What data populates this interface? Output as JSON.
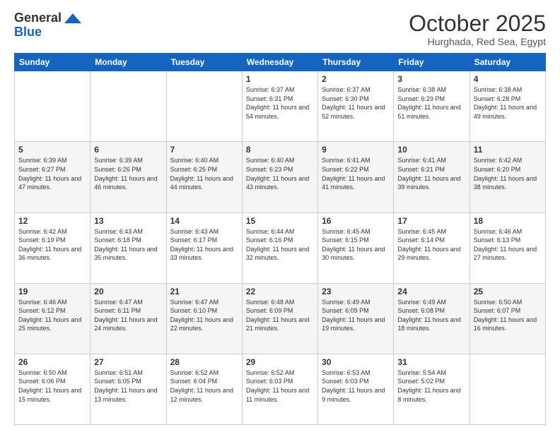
{
  "header": {
    "logo_general": "General",
    "logo_blue": "Blue",
    "month_title": "October 2025",
    "location": "Hurghada, Red Sea, Egypt"
  },
  "days_of_week": [
    "Sunday",
    "Monday",
    "Tuesday",
    "Wednesday",
    "Thursday",
    "Friday",
    "Saturday"
  ],
  "weeks": [
    [
      {
        "day": "",
        "detail": ""
      },
      {
        "day": "",
        "detail": ""
      },
      {
        "day": "",
        "detail": ""
      },
      {
        "day": "1",
        "detail": "Sunrise: 6:37 AM\nSunset: 6:31 PM\nDaylight: 11 hours\nand 54 minutes."
      },
      {
        "day": "2",
        "detail": "Sunrise: 6:37 AM\nSunset: 6:30 PM\nDaylight: 11 hours\nand 52 minutes."
      },
      {
        "day": "3",
        "detail": "Sunrise: 6:38 AM\nSunset: 6:29 PM\nDaylight: 11 hours\nand 51 minutes."
      },
      {
        "day": "4",
        "detail": "Sunrise: 6:38 AM\nSunset: 6:28 PM\nDaylight: 11 hours\nand 49 minutes."
      }
    ],
    [
      {
        "day": "5",
        "detail": "Sunrise: 6:39 AM\nSunset: 6:27 PM\nDaylight: 11 hours\nand 47 minutes."
      },
      {
        "day": "6",
        "detail": "Sunrise: 6:39 AM\nSunset: 6:26 PM\nDaylight: 11 hours\nand 46 minutes."
      },
      {
        "day": "7",
        "detail": "Sunrise: 6:40 AM\nSunset: 6:25 PM\nDaylight: 11 hours\nand 44 minutes."
      },
      {
        "day": "8",
        "detail": "Sunrise: 6:40 AM\nSunset: 6:23 PM\nDaylight: 11 hours\nand 43 minutes."
      },
      {
        "day": "9",
        "detail": "Sunrise: 6:41 AM\nSunset: 6:22 PM\nDaylight: 11 hours\nand 41 minutes."
      },
      {
        "day": "10",
        "detail": "Sunrise: 6:41 AM\nSunset: 6:21 PM\nDaylight: 11 hours\nand 39 minutes."
      },
      {
        "day": "11",
        "detail": "Sunrise: 6:42 AM\nSunset: 6:20 PM\nDaylight: 11 hours\nand 38 minutes."
      }
    ],
    [
      {
        "day": "12",
        "detail": "Sunrise: 6:42 AM\nSunset: 6:19 PM\nDaylight: 11 hours\nand 36 minutes."
      },
      {
        "day": "13",
        "detail": "Sunrise: 6:43 AM\nSunset: 6:18 PM\nDaylight: 11 hours\nand 35 minutes."
      },
      {
        "day": "14",
        "detail": "Sunrise: 6:43 AM\nSunset: 6:17 PM\nDaylight: 11 hours\nand 33 minutes."
      },
      {
        "day": "15",
        "detail": "Sunrise: 6:44 AM\nSunset: 6:16 PM\nDaylight: 11 hours\nand 32 minutes."
      },
      {
        "day": "16",
        "detail": "Sunrise: 6:45 AM\nSunset: 6:15 PM\nDaylight: 11 hours\nand 30 minutes."
      },
      {
        "day": "17",
        "detail": "Sunrise: 6:45 AM\nSunset: 6:14 PM\nDaylight: 11 hours\nand 29 minutes."
      },
      {
        "day": "18",
        "detail": "Sunrise: 6:46 AM\nSunset: 6:13 PM\nDaylight: 11 hours\nand 27 minutes."
      }
    ],
    [
      {
        "day": "19",
        "detail": "Sunrise: 6:46 AM\nSunset: 6:12 PM\nDaylight: 11 hours\nand 25 minutes."
      },
      {
        "day": "20",
        "detail": "Sunrise: 6:47 AM\nSunset: 6:11 PM\nDaylight: 11 hours\nand 24 minutes."
      },
      {
        "day": "21",
        "detail": "Sunrise: 6:47 AM\nSunset: 6:10 PM\nDaylight: 11 hours\nand 22 minutes."
      },
      {
        "day": "22",
        "detail": "Sunrise: 6:48 AM\nSunset: 6:09 PM\nDaylight: 11 hours\nand 21 minutes."
      },
      {
        "day": "23",
        "detail": "Sunrise: 6:49 AM\nSunset: 6:09 PM\nDaylight: 11 hours\nand 19 minutes."
      },
      {
        "day": "24",
        "detail": "Sunrise: 6:49 AM\nSunset: 6:08 PM\nDaylight: 11 hours\nand 18 minutes."
      },
      {
        "day": "25",
        "detail": "Sunrise: 6:50 AM\nSunset: 6:07 PM\nDaylight: 11 hours\nand 16 minutes."
      }
    ],
    [
      {
        "day": "26",
        "detail": "Sunrise: 6:50 AM\nSunset: 6:06 PM\nDaylight: 11 hours\nand 15 minutes."
      },
      {
        "day": "27",
        "detail": "Sunrise: 6:51 AM\nSunset: 6:05 PM\nDaylight: 11 hours\nand 13 minutes."
      },
      {
        "day": "28",
        "detail": "Sunrise: 6:52 AM\nSunset: 6:04 PM\nDaylight: 11 hours\nand 12 minutes."
      },
      {
        "day": "29",
        "detail": "Sunrise: 6:52 AM\nSunset: 6:03 PM\nDaylight: 11 hours\nand 11 minutes."
      },
      {
        "day": "30",
        "detail": "Sunrise: 6:53 AM\nSunset: 6:03 PM\nDaylight: 11 hours\nand 9 minutes."
      },
      {
        "day": "31",
        "detail": "Sunrise: 5:54 AM\nSunset: 5:02 PM\nDaylight: 11 hours\nand 8 minutes."
      },
      {
        "day": "",
        "detail": ""
      }
    ]
  ]
}
